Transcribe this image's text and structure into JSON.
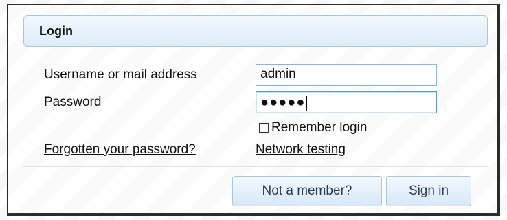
{
  "dialog": {
    "title": "Login"
  },
  "form": {
    "username_label": "Username or mail address",
    "username_value": "admin",
    "password_label": "Password",
    "password_masked": "●●●●●",
    "remember_label": "Remember login",
    "remember_checked": false
  },
  "links": {
    "forgot_password": "Forgotten your password?",
    "network_testing": "Network testing"
  },
  "buttons": {
    "not_member": "Not a member?",
    "sign_in": "Sign in"
  }
}
